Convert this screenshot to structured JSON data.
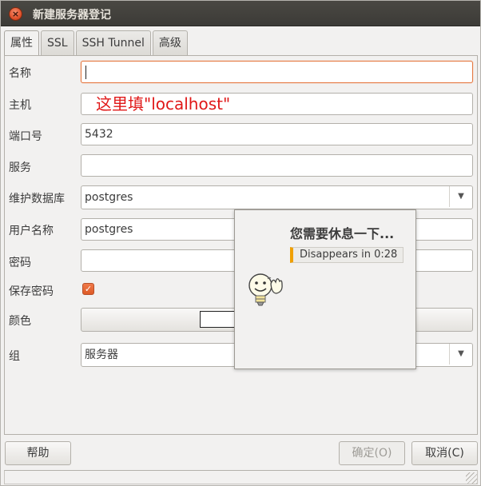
{
  "window": {
    "title": "新建服务器登记"
  },
  "tabs": [
    {
      "label": "属性",
      "active": true
    },
    {
      "label": "SSL",
      "active": false
    },
    {
      "label": "SSH Tunnel",
      "active": false
    },
    {
      "label": "高级",
      "active": false
    }
  ],
  "form": {
    "name": {
      "label": "名称",
      "value": ""
    },
    "host": {
      "label": "主机",
      "value": "这里填\"localhost\""
    },
    "port": {
      "label": "端口号",
      "value": "5432"
    },
    "service": {
      "label": "服务",
      "value": ""
    },
    "maint_db": {
      "label": "维护数据库",
      "value": "postgres"
    },
    "username": {
      "label": "用户名称",
      "value": "postgres"
    },
    "password": {
      "label": "密码",
      "value": ""
    },
    "save_password": {
      "label": "保存密码",
      "checked": true
    },
    "color": {
      "label": "颜色",
      "value": "#ffffff"
    },
    "group": {
      "label": "组",
      "value": "服务器"
    }
  },
  "buttons": {
    "help": "帮助",
    "ok": "确定(O)",
    "cancel": "取消(C)"
  },
  "notification": {
    "title": "您需要休息一下...",
    "timer": "Disappears in 0:28",
    "icon": "lightbulb-smiley-waving-icon"
  },
  "colors": {
    "accent": "#e5773f",
    "annotation": "#e01818",
    "timer_bar": "#f0a000"
  }
}
